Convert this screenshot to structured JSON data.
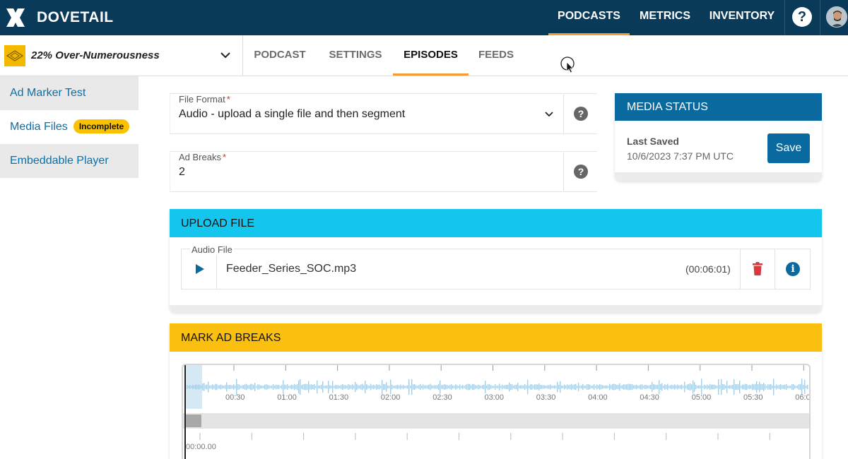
{
  "brand": {
    "name": "DOVETAIL"
  },
  "topnav": {
    "items": [
      {
        "label": "PODCASTS",
        "active": true
      },
      {
        "label": "METRICS",
        "active": false
      },
      {
        "label": "INVENTORY",
        "active": false
      }
    ],
    "help_glyph": "?"
  },
  "podcast": {
    "title": "22% Over-Numerousness"
  },
  "tabs": [
    {
      "label": "PODCAST",
      "active": false
    },
    {
      "label": "SETTINGS",
      "active": false
    },
    {
      "label": "EPISODES",
      "active": true
    },
    {
      "label": "FEEDS",
      "active": false
    }
  ],
  "sidebar": {
    "items": [
      {
        "label": "Ad Marker Test"
      },
      {
        "label": "Media Files",
        "badge": "Incomplete"
      },
      {
        "label": "Embeddable Player"
      }
    ]
  },
  "form": {
    "file_format": {
      "label": "File Format",
      "required_mark": "*",
      "value": "Audio - upload a single file and then segment"
    },
    "ad_breaks": {
      "label": "Ad Breaks",
      "required_mark": "*",
      "value": "2"
    },
    "help_glyph": "?"
  },
  "media_status": {
    "title": "MEDIA STATUS",
    "last_saved_label": "Last Saved",
    "last_saved_value": "10/6/2023 7:37 PM UTC",
    "save_label": "Save"
  },
  "upload": {
    "title": "UPLOAD FILE",
    "audio_label": "Audio File",
    "file_name": "Feeder_Series_SOC.mp3",
    "duration": "(00:06:01)",
    "info_glyph": "i"
  },
  "ad_breaks_section": {
    "title": "MARK AD BREAKS",
    "timeline_ticks": [
      "00:30",
      "01:00",
      "01:30",
      "02:00",
      "02:30",
      "03:00",
      "03:30",
      "04:00",
      "04:30",
      "05:00",
      "05:30",
      "06:0"
    ],
    "ruler_start": "00:00.00"
  },
  "colors": {
    "nav_bg": "#0a3a5a",
    "accent_orange": "#f39c38",
    "brand_blue": "#0a6aa0",
    "upload_header": "#14c6ee",
    "adbreak_header": "#fbbf10",
    "badge_yellow": "#f8c200",
    "delete_red": "#d9383f"
  },
  "icons": {
    "brand": "dovetail-x-logo",
    "help": "question-circle-icon",
    "chevron": "chevron-down-icon",
    "play": "play-icon",
    "trash": "trash-icon",
    "info": "info-circle-icon",
    "pointer": "mouse-pointer-icon"
  }
}
